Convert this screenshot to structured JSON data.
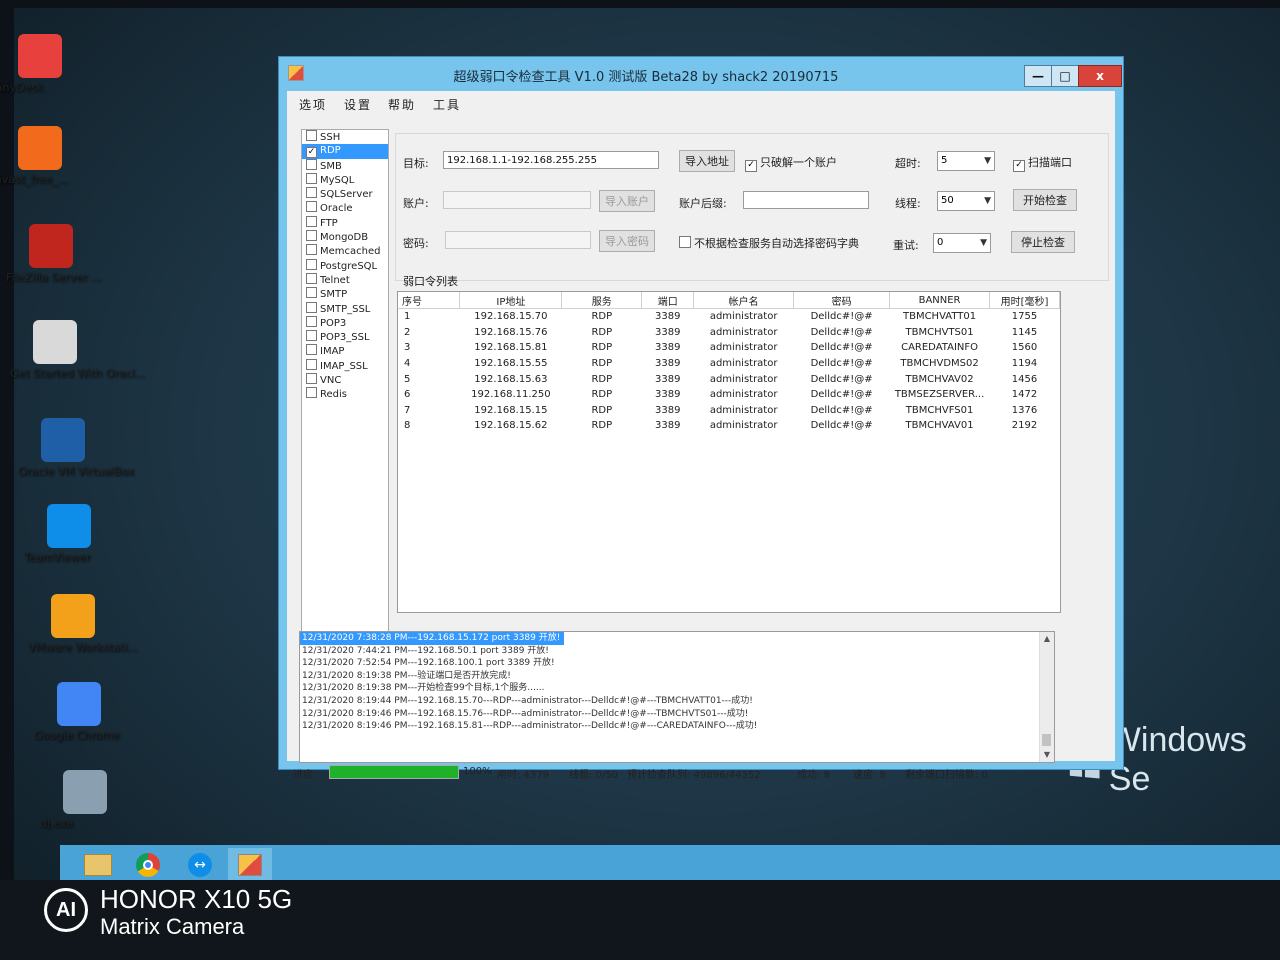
{
  "desktop": {
    "icons": [
      {
        "label": "AnyDesk",
        "icon": "anydesk-icon",
        "color": "#e8413d"
      },
      {
        "label": "avast_free_...",
        "icon": "avast-icon",
        "color": "#f26b1d"
      },
      {
        "label": "FileZilla Server ...",
        "icon": "filezilla-icon",
        "color": "#c0261e"
      },
      {
        "label": "Get Started With Oracl...",
        "icon": "oracle-db-icon",
        "color": "#d9d9d9"
      },
      {
        "label": "Oracle VM VirtualBox",
        "icon": "virtualbox-icon",
        "color": "#1f5fa8"
      },
      {
        "label": "TeamViewer",
        "icon": "teamviewer-icon",
        "color": "#0e8ee9"
      },
      {
        "label": "VMware Workstati...",
        "icon": "vmware-icon",
        "color": "#f3a11b"
      },
      {
        "label": "Google Chrome",
        "icon": "chrome-icon",
        "color": "#4285f4"
      },
      {
        "label": "dj.exe",
        "icon": "exe-icon",
        "color": "#8aa0b0"
      }
    ],
    "wallpaper_brand": "Windows Se"
  },
  "camera": {
    "line1": "HONOR X10 5G",
    "line2": "Matrix Camera"
  },
  "window": {
    "title": "超级弱口令检查工具 V1.0 测试版 Beta28 by shack2 20190715",
    "controls": {
      "minimize": "—",
      "maximize": "□",
      "close": "x"
    },
    "menu": [
      "选项",
      "设置",
      "帮助",
      "工具"
    ],
    "services": [
      {
        "name": "SSH",
        "checked": false
      },
      {
        "name": "RDP",
        "checked": true,
        "selected": true
      },
      {
        "name": "SMB",
        "checked": false
      },
      {
        "name": "MySQL",
        "checked": false
      },
      {
        "name": "SQLServer",
        "checked": false
      },
      {
        "name": "Oracle",
        "checked": false
      },
      {
        "name": "FTP",
        "checked": false
      },
      {
        "name": "MongoDB",
        "checked": false
      },
      {
        "name": "Memcached",
        "checked": false
      },
      {
        "name": "PostgreSQL",
        "checked": false
      },
      {
        "name": "Telnet",
        "checked": false
      },
      {
        "name": "SMTP",
        "checked": false
      },
      {
        "name": "SMTP_SSL",
        "checked": false
      },
      {
        "name": "POP3",
        "checked": false
      },
      {
        "name": "POP3_SSL",
        "checked": false
      },
      {
        "name": "IMAP",
        "checked": false
      },
      {
        "name": "IMAP_SSL",
        "checked": false
      },
      {
        "name": "VNC",
        "checked": false
      },
      {
        "name": "Redis",
        "checked": false
      }
    ],
    "form": {
      "target_label": "目标:",
      "target_value": "192.168.1.1-192.168.255.255",
      "import_address": "导入地址",
      "only_one_account": "只破解一个账户",
      "timeout_label": "超时:",
      "timeout_value": "5",
      "scan_port": "扫描端口",
      "account_label": "账户:",
      "import_account": "导入账户",
      "account_suffix_label": "账户后缀:",
      "threads_label": "线程:",
      "threads_value": "50",
      "start_check": "开始检查",
      "password_label": "密码:",
      "import_password": "导入密码",
      "auto_dict": "不根据检查服务自动选择密码字典",
      "retry_label": "重试:",
      "retry_value": "0",
      "stop_check": "停止检查"
    },
    "table": {
      "caption": "弱口令列表",
      "headers": [
        "序号",
        "IP地址",
        "服务",
        "端口",
        "帐户名",
        "密码",
        "BANNER",
        "用时[毫秒]"
      ],
      "rows": [
        [
          "1",
          "192.168.15.70",
          "RDP",
          "3389",
          "administrator",
          "Delldc#!@#",
          "TBMCHVATT01",
          "1755"
        ],
        [
          "2",
          "192.168.15.76",
          "RDP",
          "3389",
          "administrator",
          "Delldc#!@#",
          "TBMCHVTS01",
          "1145"
        ],
        [
          "3",
          "192.168.15.81",
          "RDP",
          "3389",
          "administrator",
          "Delldc#!@#",
          "CAREDATAINFO",
          "1560"
        ],
        [
          "4",
          "192.168.15.55",
          "RDP",
          "3389",
          "administrator",
          "Delldc#!@#",
          "TBMCHVDMS02",
          "1194"
        ],
        [
          "5",
          "192.168.15.63",
          "RDP",
          "3389",
          "administrator",
          "Delldc#!@#",
          "TBMCHVAV02",
          "1456"
        ],
        [
          "6",
          "192.168.11.250",
          "RDP",
          "3389",
          "administrator",
          "Delldc#!@#",
          "TBMSEZSERVER...",
          "1472"
        ],
        [
          "7",
          "192.168.15.15",
          "RDP",
          "3389",
          "administrator",
          "Delldc#!@#",
          "TBMCHVFS01",
          "1376"
        ],
        [
          "8",
          "192.168.15.62",
          "RDP",
          "3389",
          "administrator",
          "Delldc#!@#",
          "TBMCHVAV01",
          "2192"
        ]
      ]
    },
    "log": [
      "12/31/2020 7:38:28 PM---192.168.15.172 port 3389 开放!",
      "12/31/2020 7:44:21 PM---192.168.50.1 port 3389 开放!",
      "12/31/2020 7:52:54 PM---192.168.100.1 port 3389 开放!",
      "12/31/2020 8:19:38 PM---验证端口是否开放完成!",
      "12/31/2020 8:19:38 PM---开始检查99个目标,1个服务......",
      "12/31/2020 8:19:44 PM---192.168.15.70---RDP---administrator---Delldc#!@#---TBMCHVATT01---成功!",
      "12/31/2020 8:19:46 PM---192.168.15.76---RDP---administrator---Delldc#!@#---TBMCHVTS01---成功!",
      "12/31/2020 8:19:46 PM---192.168.15.81---RDP---administrator---Delldc#!@#---CAREDATAINFO---成功!"
    ],
    "status": {
      "progress_label": "进度:",
      "progress_percent": "100%",
      "progress_fraction": 1.0,
      "elapsed": "用时: 4379",
      "threads": "线程: 0/50",
      "queue": "预计检查队列: 49896/44352",
      "success": "成功: 8",
      "speed": "速度: 8",
      "remaining": "剩余端口扫描数: 0"
    }
  },
  "colors": {
    "selection": "#3399ff",
    "progress": "#1fb12a",
    "titlebar": "#77c4ec",
    "close": "#d9443a",
    "taskbar": "#4aa3d6"
  }
}
